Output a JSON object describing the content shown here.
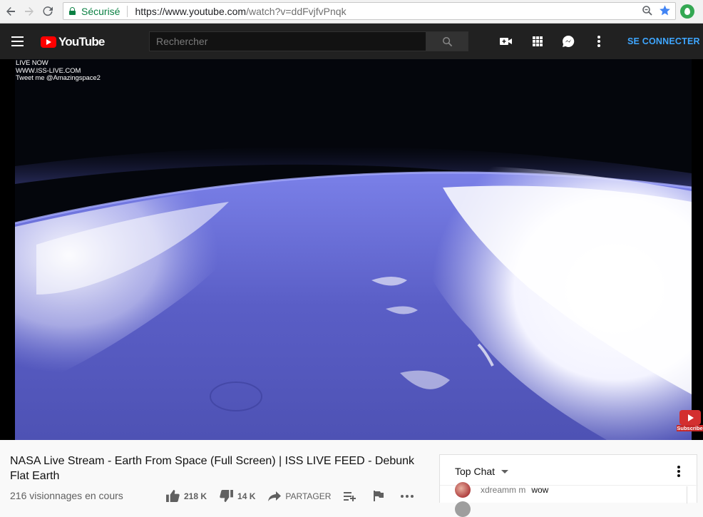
{
  "browser": {
    "secure_label": "Sécurisé",
    "url_host": "https://www.youtube.com",
    "url_path": "/watch?v=ddFvjfvPnqk"
  },
  "header": {
    "logo_text": "YouTube",
    "search_placeholder": "Rechercher",
    "signin_label": "SE CONNECTER"
  },
  "video": {
    "overlay_line1": "LIVE NOW",
    "overlay_line2": "WWW.ISS-LIVE.COM",
    "overlay_line3": "Tweet me @Amazingspace2",
    "watermark_label": "Subscribe",
    "title": "NASA Live Stream - Earth From Space (Full Screen) | ISS LIVE FEED - Debunk Flat Earth",
    "views": "216 visionnages en cours",
    "likes": "218 K",
    "dislikes": "14 K",
    "share_label": "PARTAGER"
  },
  "chat": {
    "title": "Top Chat",
    "messages": [
      {
        "author": "xdreamm m",
        "text": "wow"
      }
    ]
  }
}
